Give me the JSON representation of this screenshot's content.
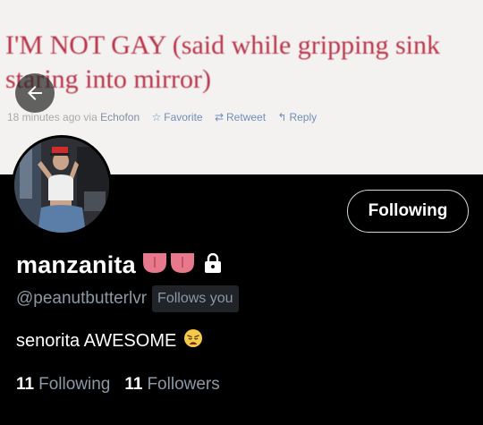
{
  "banner": {
    "tweet_text": "I'M NOT GAY (said while gripping sink staring into mirror)",
    "meta_time": "18 minutes ago",
    "meta_via": "via",
    "meta_app": "Echofon",
    "favorite_label": "Favorite",
    "retweet_label": "Retweet",
    "reply_label": "Reply"
  },
  "profile": {
    "display_name": "manzanita",
    "handle": "@peanutbutterlvr",
    "follows_you_label": "Follows you",
    "follow_button_label": "Following",
    "bio": "senorita AWESOME",
    "stats": {
      "following_count": "11",
      "following_label": "Following",
      "followers_count": "11",
      "followers_label": "Followers"
    }
  },
  "icons": {
    "back": "arrow-left-icon",
    "lock": "lock-icon",
    "name_emoji": "tongue-emoji",
    "bio_emoji": "weary-face-emoji"
  },
  "colors": {
    "background": "#000000",
    "banner_background": "#f4f2f0",
    "tweet_text": "#b8344a",
    "secondary_text": "#8b98a5"
  }
}
